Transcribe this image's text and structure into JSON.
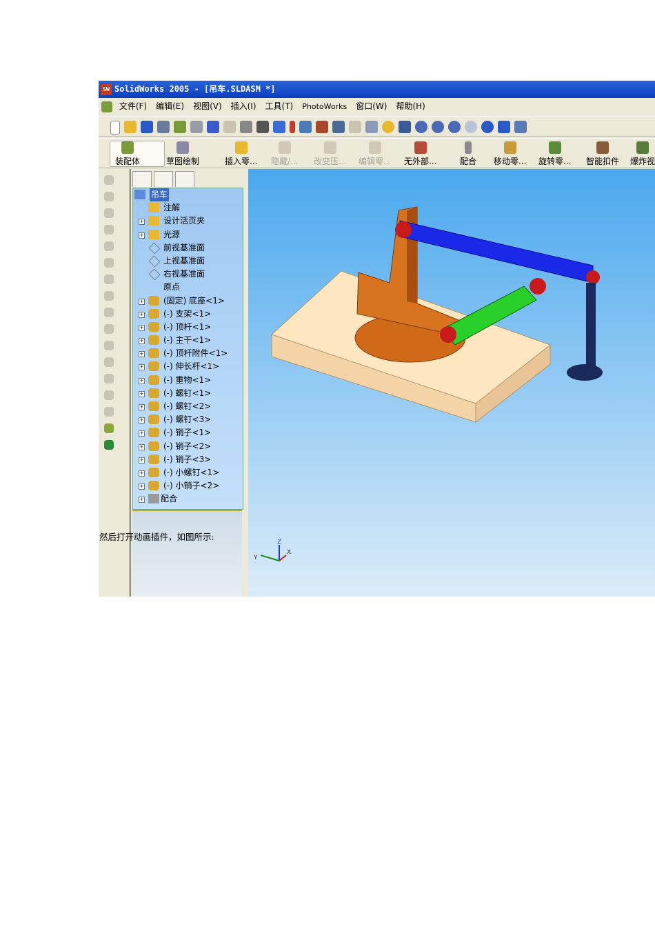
{
  "window": {
    "title": "SolidWorks 2005 - [吊车.SLDASM *]",
    "logo": "SW"
  },
  "menu": [
    "文件(F)",
    "编辑(E)",
    "视图(V)",
    "插入(I)",
    "工具(T)",
    "PhotoWorks",
    "窗口(W)",
    "帮助(H)"
  ],
  "assembly_toolbar": [
    {
      "label": "装配体",
      "enabled": true
    },
    {
      "label": "草图绘制",
      "enabled": true
    },
    {
      "label": "插入零...",
      "enabled": true
    },
    {
      "label": "隐藏/...",
      "enabled": false
    },
    {
      "label": "改变压...",
      "enabled": false
    },
    {
      "label": "编辑零...",
      "enabled": false
    },
    {
      "label": "无外部...",
      "enabled": true
    },
    {
      "label": "配合",
      "enabled": true
    },
    {
      "label": "移动零...",
      "enabled": true
    },
    {
      "label": "旋转零...",
      "enabled": true
    },
    {
      "label": "智能扣件",
      "enabled": true
    },
    {
      "label": "爆炸视",
      "enabled": true
    }
  ],
  "tree": {
    "root": "吊车",
    "items": [
      {
        "label": "注解",
        "expand": false
      },
      {
        "label": "设计活页夹",
        "expand": true
      },
      {
        "label": "光源",
        "expand": true
      },
      {
        "label": "前视基准面",
        "expand": false
      },
      {
        "label": "上视基准面",
        "expand": false
      },
      {
        "label": "右视基准面",
        "expand": false
      },
      {
        "label": "原点",
        "expand": false
      },
      {
        "label": "(固定) 底座<1>",
        "expand": true
      },
      {
        "label": "(-) 支架<1>",
        "expand": true
      },
      {
        "label": "(-) 顶杆<1>",
        "expand": true
      },
      {
        "label": "(-) 主干<1>",
        "expand": true
      },
      {
        "label": "(-) 顶杆附件<1>",
        "expand": true
      },
      {
        "label": "(-) 伸长杆<1>",
        "expand": true
      },
      {
        "label": "(-) 重物<1>",
        "expand": true
      },
      {
        "label": "(-) 螺钉<1>",
        "expand": true
      },
      {
        "label": "(-) 螺钉<2>",
        "expand": true
      },
      {
        "label": "(-) 螺钉<3>",
        "expand": true
      },
      {
        "label": "(-) 销子<1>",
        "expand": true
      },
      {
        "label": "(-) 销子<2>",
        "expand": true
      },
      {
        "label": "(-) 销子<3>",
        "expand": true
      },
      {
        "label": "(-) 小螺钉<1>",
        "expand": true
      },
      {
        "label": "(-) 小销子<2>",
        "expand": true
      },
      {
        "label": "配合",
        "expand": true
      }
    ]
  },
  "triad": {
    "x": "X",
    "y": "Y",
    "z": "Z"
  },
  "caption": "然后打开动画插件，如图所示:"
}
